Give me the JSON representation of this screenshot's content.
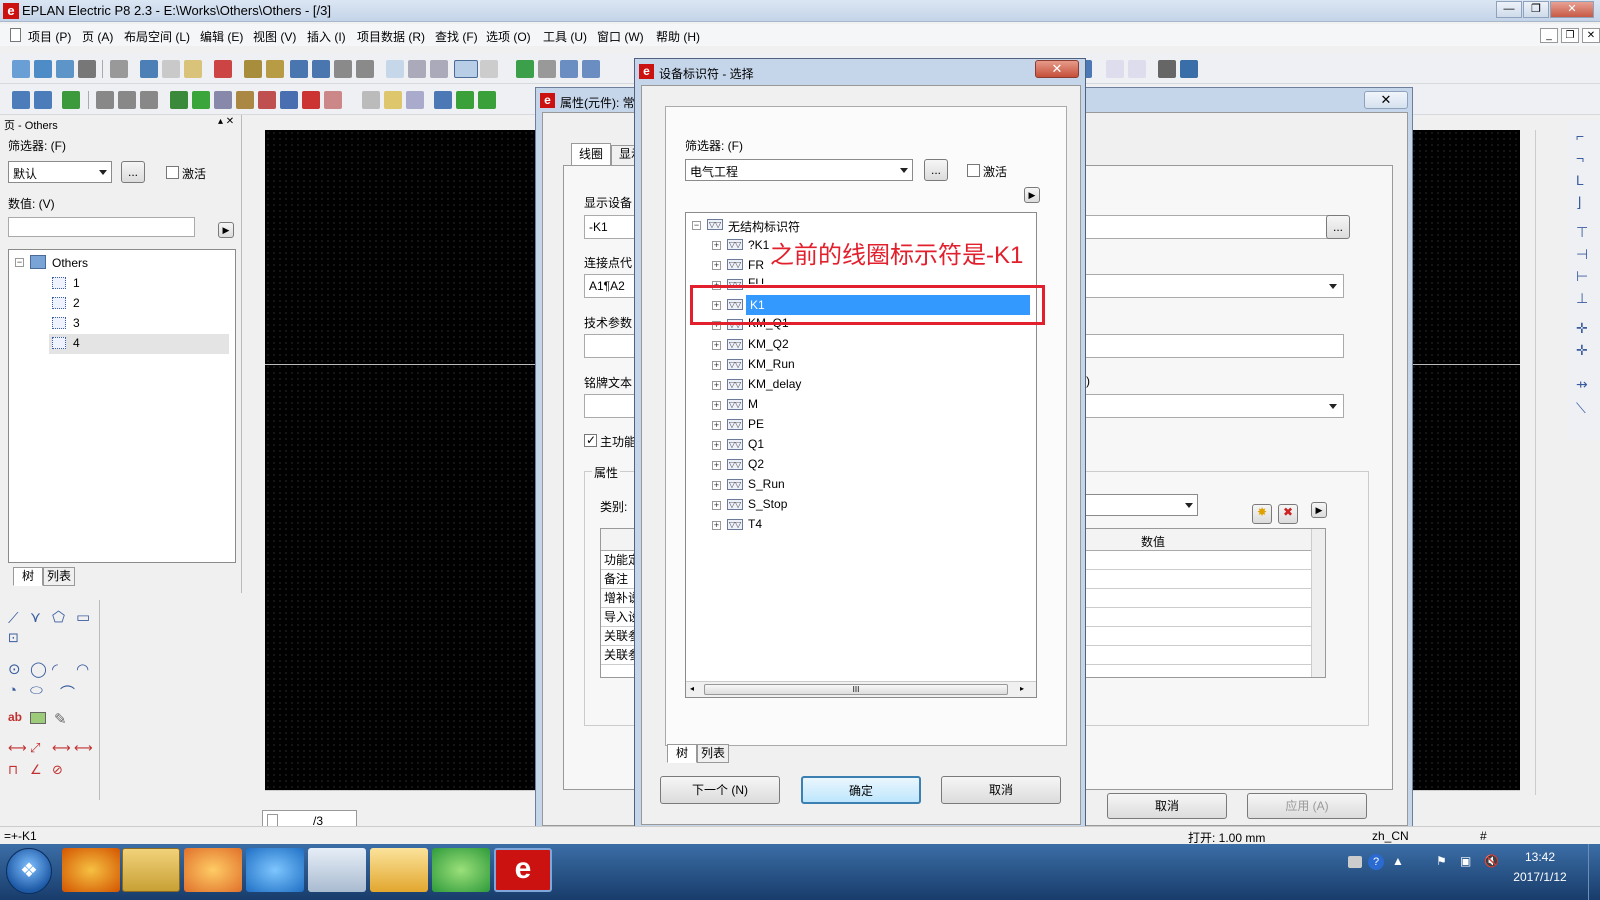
{
  "window": {
    "title": "EPLAN Electric P8 2.3 - E:\\Works\\Others\\Others - [/3]",
    "app_icon": "e"
  },
  "menu": [
    "项目 (P)",
    "页 (A)",
    "布局空间 (L)",
    "编辑 (E)",
    "视图 (V)",
    "插入 (I)",
    "项目数据 (R)",
    "查找 (F)",
    "选项 (O)",
    "工具 (U)",
    "窗口 (W)",
    "帮助 (H)"
  ],
  "page_pane": {
    "title": "页 - Others",
    "filter_label": "筛选器: (F)",
    "filter_value": "默认",
    "browse_label": "...",
    "activate_label": "激活",
    "value_label": "数值: (V)",
    "tree": {
      "root": "Others",
      "pages": [
        "1",
        "2",
        "3",
        "4"
      ]
    },
    "tabs": [
      "树",
      "列表"
    ]
  },
  "canvas": {
    "page_tab": "/3"
  },
  "properties_dialog": {
    "title": "属性(元件): 常",
    "tabs": [
      "线圈",
      "显示"
    ],
    "display_device_label": "显示设备",
    "display_device_value": "-K1",
    "connection_label": "连接点代",
    "connection_value": "A1¶A2",
    "tech_param_label": "技术参数",
    "nameplate_label": "铭牌文本",
    "main_function_label": "主功能",
    "m_label": "M)",
    "attributes_group": "属性",
    "category_label": "类别:",
    "value_col": "数值",
    "rows": [
      "功能定",
      "备注",
      "增补说",
      "导入设",
      "关联参",
      "关联参"
    ],
    "buttons": {
      "cancel": "取消",
      "apply": "应用 (A)"
    }
  },
  "selector_dialog": {
    "title": "设备标识符 - 选择",
    "filter_label": "筛选器: (F)",
    "filter_value": "电气工程",
    "browse_label": "...",
    "activate_label": "激活",
    "tree_root": "无结构标识符",
    "items": [
      "?K1",
      "FR",
      "FU",
      "K1",
      "KM_Q1",
      "KM_Q2",
      "KM_Run",
      "KM_delay",
      "M",
      "PE",
      "Q1",
      "Q2",
      "S_Run",
      "S_Stop",
      "T4"
    ],
    "selected": "K1",
    "tabs": [
      "树",
      "列表"
    ],
    "buttons": {
      "next": "下一个 (N)",
      "ok": "确定",
      "cancel": "取消"
    },
    "scroll_mark": "III"
  },
  "annotation": {
    "text": "之前的线圈标示符是-K1"
  },
  "status_bar": {
    "left": "=+-K1",
    "grid": "打开: 1.00 mm",
    "locale": "zh_CN",
    "hash": "#"
  },
  "taskbar": {
    "time": "13:42",
    "date": "2017/1/12"
  },
  "colors": {
    "accent": "#3399ff",
    "annotation": "#e2202d",
    "canvas": "#000000"
  }
}
